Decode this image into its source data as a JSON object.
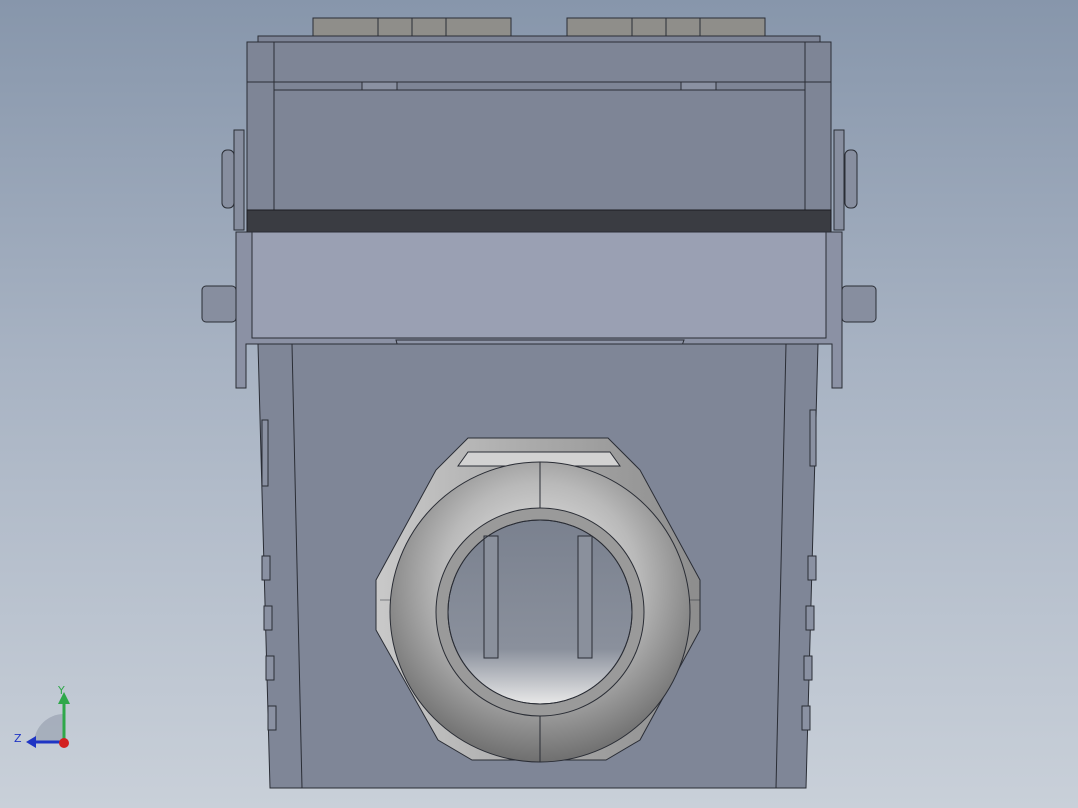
{
  "viewport": {
    "background_top": "#8796ab",
    "background_bottom": "#c9d0d9"
  },
  "model": {
    "part_fill": "#838a99",
    "outline": "#2a2d35",
    "gasket_band": "#3a3c42",
    "latch_band": "#9aa0b3",
    "gland_fill": "#a7a7a7",
    "gland_highlight": "#e6e6e6"
  },
  "triad": {
    "y_label": "Y",
    "z_label": "Z",
    "y_color": "#2fa84a",
    "z_color": "#1f35c4",
    "x_color": "#d21f1f"
  }
}
